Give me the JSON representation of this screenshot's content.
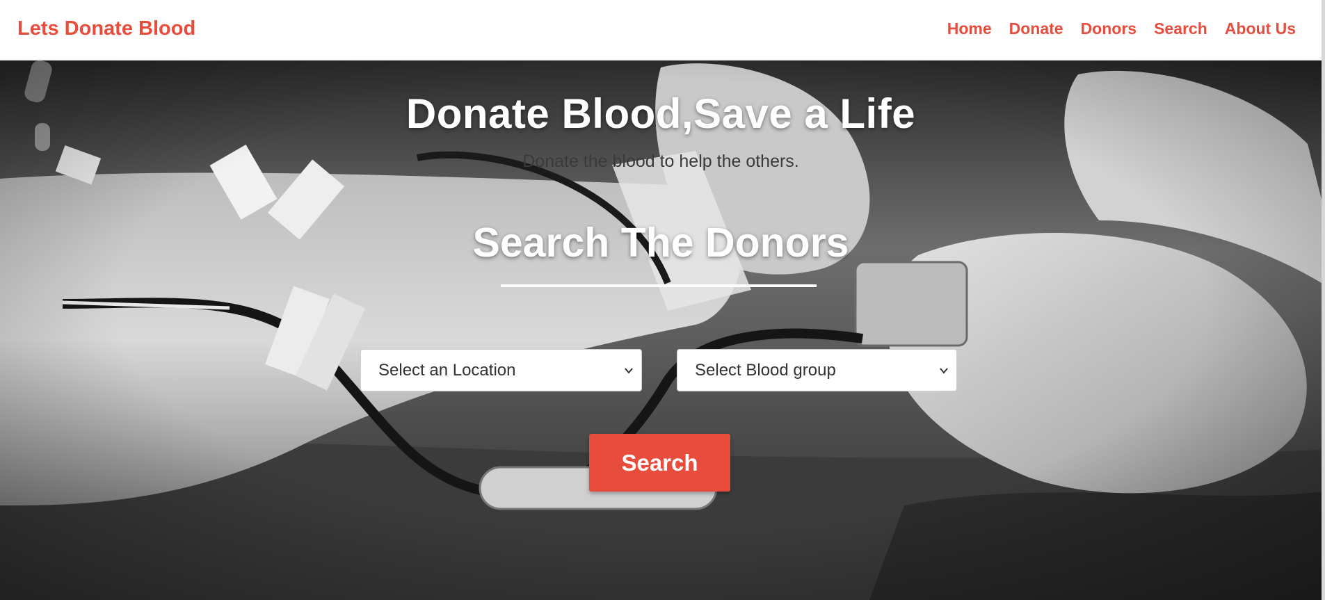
{
  "navbar": {
    "brand": "Lets Donate Blood",
    "links": [
      "Home",
      "Donate",
      "Donors",
      "Search",
      "About Us"
    ]
  },
  "hero": {
    "title": "Donate Blood,Save a Life",
    "subtitle": "Donate the blood to help the others.",
    "search_title": "Search The Donors"
  },
  "form": {
    "location_select": "Select an Location",
    "blood_group_select": "Select Blood group",
    "search_button": "Search"
  },
  "colors": {
    "accent": "#e74c3c",
    "navbar_bg": "#ffffff",
    "hero_text": "#ffffff"
  },
  "icons": {
    "select_arrow": "chevron-down-icon"
  }
}
